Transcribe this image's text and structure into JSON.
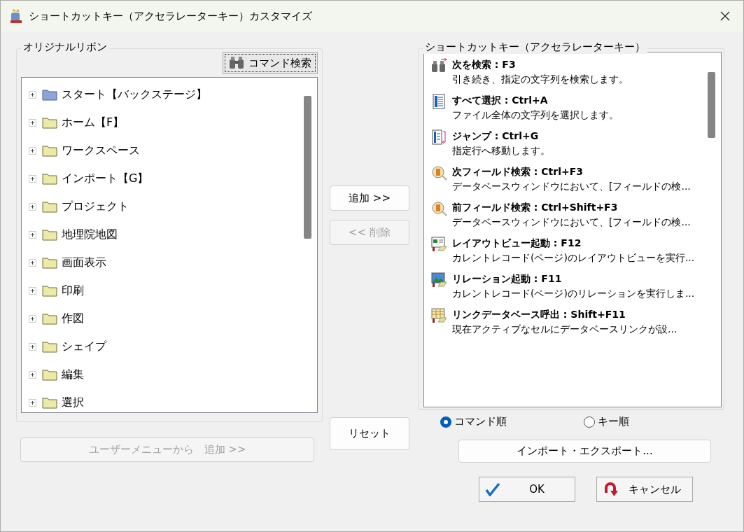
{
  "window": {
    "title": "ショートカットキー（アクセラレーターキー）カスタマイズ"
  },
  "ribbon": {
    "label": "オリジナルリボン",
    "search_button": "コマンド検索",
    "items": [
      {
        "label": "スタート【バックステージ】",
        "kind": "backstage",
        "expanded": false
      },
      {
        "label": "ホーム【F】",
        "kind": "folder",
        "expanded": false
      },
      {
        "label": "ワークスペース",
        "kind": "folder",
        "expanded": false
      },
      {
        "label": "インポート【G】",
        "kind": "folder",
        "expanded": false
      },
      {
        "label": "プロジェクト",
        "kind": "folder",
        "expanded": false
      },
      {
        "label": "地理院地図",
        "kind": "folder",
        "expanded": false
      },
      {
        "label": "画面表示",
        "kind": "folder",
        "expanded": false
      },
      {
        "label": "印刷",
        "kind": "folder",
        "expanded": false
      },
      {
        "label": "作図",
        "kind": "folder",
        "expanded": false
      },
      {
        "label": "シェイプ",
        "kind": "folder",
        "expanded": false
      },
      {
        "label": "編集",
        "kind": "folder",
        "expanded": false
      },
      {
        "label": "選択",
        "kind": "folder",
        "expanded": false
      }
    ],
    "user_menu_button": {
      "label": "ユーザーメニューから　追加 >>",
      "disabled": true
    }
  },
  "middle_buttons": [
    {
      "label": "追加 >>",
      "disabled": false
    },
    {
      "label": "<< 削除",
      "disabled": true
    },
    {
      "label": "リセット",
      "disabled": false
    }
  ],
  "shortcuts": {
    "label": "ショートカットキー（アクセラレーターキー）",
    "items": [
      {
        "title": "次を検索 : F3",
        "description": "引き続き、指定の文字列を検索します。",
        "kind": "binoculars"
      },
      {
        "title": "すべて選択 : Ctrl+A",
        "description": "ファイル全体の文字列を選択します。",
        "kind": "document"
      },
      {
        "title": "ジャンプ : Ctrl+G",
        "description": "指定行へ移動します。",
        "kind": "jump"
      },
      {
        "title": "次フィールド検索 : Ctrl+F3",
        "description": "データベースウィンドウにおいて、[フィールドの検...",
        "kind": "field-search"
      },
      {
        "title": "前フィールド検索 : Ctrl+Shift+F3",
        "description": "データベースウィンドウにおいて、[フィールドの検...",
        "kind": "field-search"
      },
      {
        "title": "レイアウトビュー起動 : F12",
        "description": "カレントレコード(ページ)のレイアウトビューを実行...",
        "kind": "layout"
      },
      {
        "title": "リレーション起動 : F11",
        "description": "カレントレコード(ページ)のリレーションを実行しま...",
        "kind": "relation"
      },
      {
        "title": "リンクデータベース呼出 : Shift+F11",
        "description": "現在アクティブなセルにデータベースリンクが設...",
        "kind": "table"
      }
    ]
  },
  "sort_options": [
    {
      "label": "コマンド順",
      "selected": true
    },
    {
      "label": "キー順",
      "selected": false
    }
  ],
  "import_export_button": "インポート・エクスポート...",
  "ok_button": "OK",
  "cancel_button": "キャンセル"
}
